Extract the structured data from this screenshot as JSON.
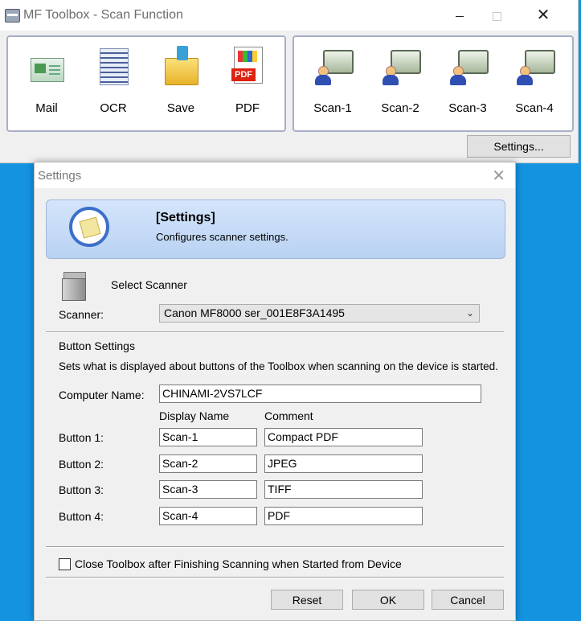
{
  "main_window": {
    "title": "MF Toolbox - Scan Function",
    "left_buttons": [
      {
        "label": "Mail",
        "icon": "mail-icon"
      },
      {
        "label": "OCR",
        "icon": "ocr-icon"
      },
      {
        "label": "Save",
        "icon": "folder-save-icon"
      },
      {
        "label": "PDF",
        "icon": "pdf-icon"
      }
    ],
    "right_buttons": [
      {
        "label": "Scan-1",
        "icon": "scan-user-icon"
      },
      {
        "label": "Scan-2",
        "icon": "scan-user-icon"
      },
      {
        "label": "Scan-3",
        "icon": "scan-user-icon"
      },
      {
        "label": "Scan-4",
        "icon": "scan-user-icon"
      }
    ],
    "settings_button": "Settings..."
  },
  "settings_dialog": {
    "title": "Settings",
    "close_glyph": "✕",
    "banner": {
      "title": "[Settings]",
      "subtitle": "Configures scanner settings."
    },
    "select_scanner_label": "Select Scanner",
    "scanner_label": "Scanner:",
    "scanner_value": "Canon MF8000 ser_001E8F3A1495",
    "button_settings_heading": "Button Settings",
    "button_settings_desc": "Sets what is displayed about buttons of the Toolbox when scanning on the device is started.",
    "computer_name_label": "Computer Name:",
    "computer_name_value": "CHINAMI-2VS7LCF",
    "col_display_name": "Display Name",
    "col_comment": "Comment",
    "rows": [
      {
        "label": "Button 1:",
        "display": "Scan-1",
        "comment": "Compact PDF"
      },
      {
        "label": "Button 2:",
        "display": "Scan-2",
        "comment": "JPEG"
      },
      {
        "label": "Button 3:",
        "display": "Scan-3",
        "comment": "TIFF"
      },
      {
        "label": "Button 4:",
        "display": "Scan-4",
        "comment": "PDF"
      }
    ],
    "close_toolbox_label": "Close Toolbox after Finishing Scanning when Started from Device",
    "close_toolbox_checked": false,
    "reset_label": "Reset",
    "ok_label": "OK",
    "cancel_label": "Cancel"
  }
}
